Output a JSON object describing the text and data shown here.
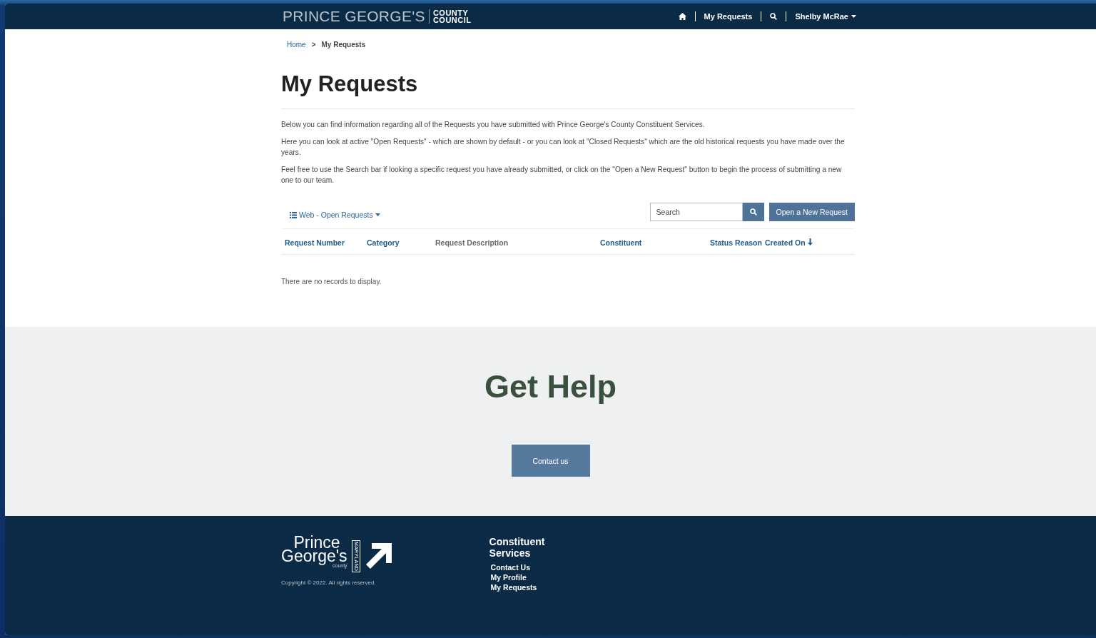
{
  "header": {
    "logo": {
      "main": "PRINCE GEORGE'S",
      "sub_1": "COUNTY",
      "sub_2": "COUNCIL"
    },
    "nav": [
      {
        "kind": "home"
      },
      {
        "kind": "link",
        "label": "My Requests"
      },
      {
        "kind": "search"
      },
      {
        "kind": "menu",
        "label": "Shelby McRae"
      }
    ]
  },
  "breadcrumb": [
    {
      "label": "Home",
      "kind": "link"
    },
    {
      "label": ">",
      "kind": "separator"
    },
    {
      "label": "My Requests",
      "kind": "current"
    }
  ],
  "title": "My Requests",
  "paragraphs": [
    "Below you can find information regarding all of the Requests you have submitted with Prince George's County Constituent Services.",
    "Here you can look at active \"Open Requests\" - which are shown by default - or you can look at \"Closed Requests\" which are the old historical requests you have made over the years.",
    "Feel free to use the Search bar if looking a specific request you have already submitted, or click on the \"Open a New Request\" button to begin the process of submitting a new one to our team."
  ],
  "toolbar": {
    "view_menu": "Web - Open Requests",
    "search": {
      "placeholder": "Search"
    },
    "new_button": "Open a New Request"
  },
  "table": {
    "columns": [
      {
        "label": "Request Number",
        "kind": "link",
        "sorted": false
      },
      {
        "label": "Category",
        "kind": "link",
        "sorted": false
      },
      {
        "label": "Request Description",
        "kind": "plain",
        "sorted": false
      },
      {
        "label": "Constituent",
        "kind": "link",
        "sorted": false
      },
      {
        "label": "Status Reason",
        "kind": "link",
        "sorted": false
      },
      {
        "label": "Created On",
        "kind": "link",
        "sorted": true
      }
    ],
    "empty_message": "There are no records to display."
  },
  "help": {
    "title": "Get Help",
    "button": "Contact us"
  },
  "footer": {
    "logo": {
      "line_1": "Prince",
      "line_2": "George's",
      "line_3": "county",
      "state": "MARYLAND"
    },
    "copyright": "Copyright © 2022. All rights reserved.",
    "links_title": "Constituent Services",
    "links": [
      "Contact Us",
      "My Profile",
      "My Requests"
    ]
  }
}
